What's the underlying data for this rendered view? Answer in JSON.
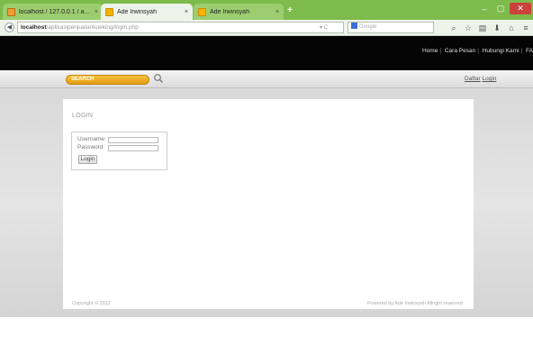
{
  "browser": {
    "tabs": [
      {
        "label": "localhost / 127.0.0.1 / adei...",
        "close": "×",
        "icon": "phpmyadmin-icon"
      },
      {
        "label": "Ade Irwinsyah",
        "close": "×",
        "icon": "page-icon"
      },
      {
        "label": "Ade Irwinsyah",
        "close": "×",
        "icon": "page-icon"
      }
    ],
    "new_tab": "+",
    "window": {
      "minimize": "–",
      "maximize": "▢",
      "close": "✕"
    },
    "url_host": "localhost",
    "url_path": "/aplikasipenjualankueking/login.php",
    "search_placeholder": "Google",
    "colors": {
      "titlebar": "#7dbb4c",
      "close": "#c9433a"
    }
  },
  "site": {
    "nav": [
      "Home",
      "Cara Pesan",
      "Hubungi Kami",
      "FA"
    ],
    "search_placeholder": "SEARCH",
    "auth": {
      "register": "Daftar",
      "login": "Login"
    },
    "login": {
      "title": "LOGIN",
      "username_label": "Username:",
      "password_label": "Password:",
      "button": "Login"
    },
    "footer": {
      "copyright": "Copyright © 2012",
      "powered": "Powered by Ade Irwinsyah Allright reserved"
    },
    "colors": {
      "header": "#050505",
      "search_accent": "#e49d11"
    }
  }
}
